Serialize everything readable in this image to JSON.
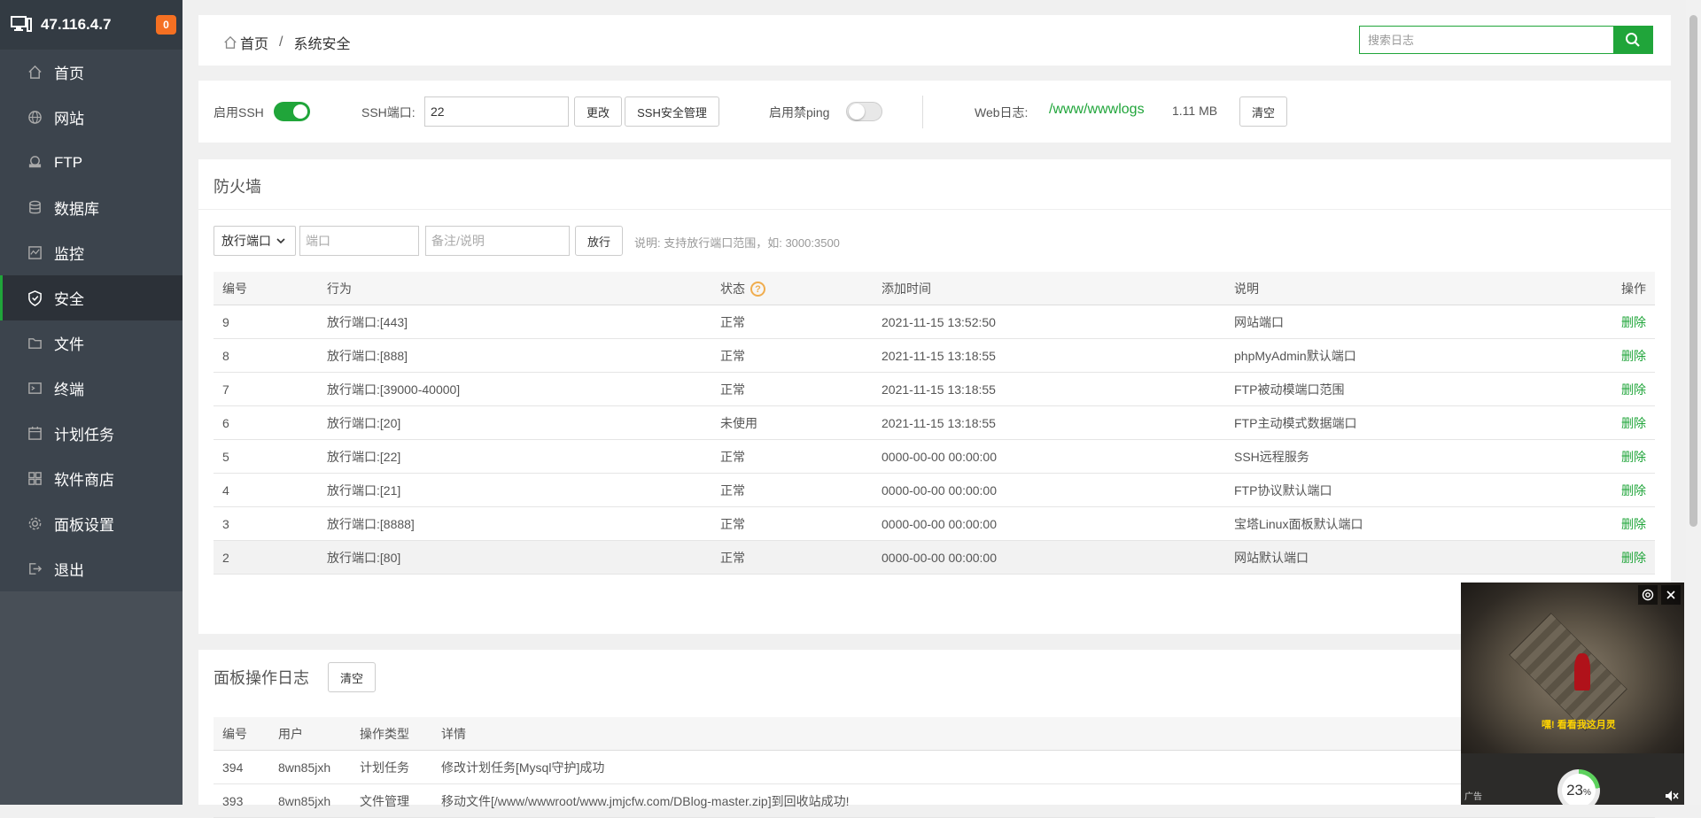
{
  "sidebar": {
    "server_ip": "47.116.4.7",
    "notify_count": "0",
    "items": [
      {
        "label": "首页",
        "icon": "home-icon"
      },
      {
        "label": "网站",
        "icon": "globe-icon"
      },
      {
        "label": "FTP",
        "icon": "ftp-icon"
      },
      {
        "label": "数据库",
        "icon": "database-icon"
      },
      {
        "label": "监控",
        "icon": "monitor-icon"
      },
      {
        "label": "安全",
        "icon": "shield-icon",
        "active": true
      },
      {
        "label": "文件",
        "icon": "folder-icon"
      },
      {
        "label": "终端",
        "icon": "terminal-icon"
      },
      {
        "label": "计划任务",
        "icon": "calendar-icon"
      },
      {
        "label": "软件商店",
        "icon": "apps-icon"
      },
      {
        "label": "面板设置",
        "icon": "gear-icon"
      },
      {
        "label": "退出",
        "icon": "logout-icon"
      }
    ]
  },
  "header": {
    "breadcrumb_home": "首页",
    "breadcrumb_sep": "/",
    "breadcrumb_current": "系统安全",
    "search_placeholder": "搜索日志"
  },
  "ssh": {
    "enable_ssh_label": "启用SSH",
    "enable_ssh_on": true,
    "port_label": "SSH端口:",
    "port_value": "22",
    "change_button": "更改",
    "manage_button": "SSH安全管理",
    "ping_label": "启用禁ping",
    "ping_on": false,
    "weblog_label": "Web日志:",
    "weblog_path": "/www/wwwlogs",
    "weblog_size": "1.11 MB",
    "clear_button": "清空"
  },
  "firewall": {
    "title": "防火墙",
    "select_value": "放行端口",
    "port_placeholder": "端口",
    "note_placeholder": "备注/说明",
    "allow_button": "放行",
    "hint": "说明: 支持放行端口范围，如: 3000:3500",
    "columns": [
      "编号",
      "行为",
      "状态",
      "添加时间",
      "说明",
      "操作"
    ],
    "rows": [
      {
        "id": "9",
        "action": "放行端口:[443]",
        "status": "正常",
        "time": "2021-11-15 13:52:50",
        "note": "网站端口",
        "op": "删除"
      },
      {
        "id": "8",
        "action": "放行端口:[888]",
        "status": "正常",
        "time": "2021-11-15 13:18:55",
        "note": "phpMyAdmin默认端口",
        "op": "删除"
      },
      {
        "id": "7",
        "action": "放行端口:[39000-40000]",
        "status": "正常",
        "time": "2021-11-15 13:18:55",
        "note": "FTP被动模端口范围",
        "op": "删除"
      },
      {
        "id": "6",
        "action": "放行端口:[20]",
        "status": "未使用",
        "time": "2021-11-15 13:18:55",
        "note": "FTP主动模式数据端口",
        "op": "删除"
      },
      {
        "id": "5",
        "action": "放行端口:[22]",
        "status": "正常",
        "time": "0000-00-00 00:00:00",
        "note": "SSH远程服务",
        "op": "删除"
      },
      {
        "id": "4",
        "action": "放行端口:[21]",
        "status": "正常",
        "time": "0000-00-00 00:00:00",
        "note": "FTP协议默认端口",
        "op": "删除"
      },
      {
        "id": "3",
        "action": "放行端口:[8888]",
        "status": "正常",
        "time": "0000-00-00 00:00:00",
        "note": "宝塔Linux面板默认端口",
        "op": "删除"
      },
      {
        "id": "2",
        "action": "放行端口:[80]",
        "status": "正常",
        "time": "0000-00-00 00:00:00",
        "note": "网站默认端口",
        "op": "删除"
      }
    ]
  },
  "logs": {
    "title": "面板操作日志",
    "clear_button": "清空",
    "columns": [
      "编号",
      "用户",
      "操作类型",
      "详情"
    ],
    "rows": [
      {
        "id": "394",
        "user": "8wn85jxh",
        "type": "计划任务",
        "detail": "修改计划任务[Mysql守护]成功"
      },
      {
        "id": "393",
        "user": "8wn85jxh",
        "type": "文件管理",
        "detail": "移动文件[/www/wwwroot/www.jmjcfw.com/DBlog-master.zip]到回收站成功!"
      }
    ]
  },
  "ad": {
    "caption": "嘿! 看看我这月灵",
    "label": "广告",
    "progress": "23",
    "progress_unit": "%",
    "progress_fraction": 0.23
  },
  "colors": {
    "accent": "#20a53a",
    "sidebar_bg": "#3c444d",
    "badge": "#f57022"
  }
}
